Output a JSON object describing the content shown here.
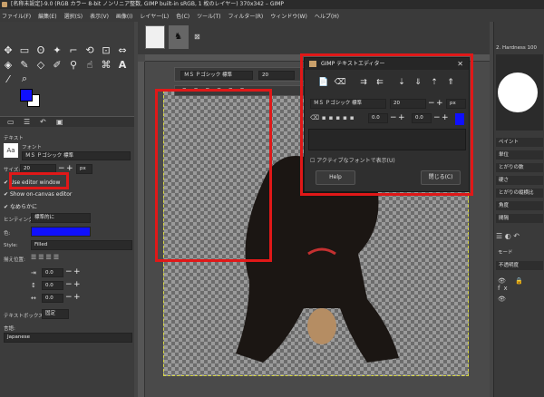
{
  "window": {
    "title": "[名称未設定]-9.0 (RGB カラー 8-bit ノンリニア整数, GIMP built-in sRGB, 1 枚のレイヤー) 370x342 – GIMP"
  },
  "menu": [
    "ファイル(F)",
    "編集(E)",
    "選択(S)",
    "表示(V)",
    "画像(I)",
    "レイヤー(L)",
    "色(C)",
    "ツール(T)",
    "フィルター(R)",
    "ウィンドウ(W)",
    "ヘルプ(H)"
  ],
  "tool_options": {
    "section_title": "テキスト",
    "font_label": "フォント",
    "font_preview": "Aa",
    "font_value": "ＭＳ Ｐゴシック 標準",
    "size_label": "サイズ:",
    "size_value": "20",
    "size_unit": "px",
    "use_editor": "Use editor window",
    "show_canvas_editor": "Show on-canvas editor",
    "antialias": "なめらかに",
    "hinting_label": "ヒンティング:",
    "hinting_value": "標準的に",
    "color_label": "色:",
    "color_hex": "#1010ff",
    "style_label": "Style:",
    "style_value": "Filled",
    "justify_label": "揃え位置:",
    "indent_value": "0.0",
    "line_spacing_value": "0.0",
    "letter_spacing_value": "0.0",
    "box_label": "テキストボックス:",
    "box_value": "固定",
    "language_label": "言語:",
    "language_value": "Japanese"
  },
  "canvas_bar": {
    "font": "ＭＳ Ｐゴシック 標準",
    "size": "20"
  },
  "text_editor": {
    "title": "GIMP テキストエディター",
    "font": "ＭＳ Ｐゴシック 標準",
    "size": "20",
    "unit": "px",
    "baseline": "0.0",
    "kerning": "0.0",
    "use_selected_font": "アクティブなフォントで表示(U)",
    "help": "Help",
    "close": "閉じる(C)"
  },
  "right_panel": {
    "brush": "2. Hardness 100",
    "items": [
      "ペイント",
      "単位",
      "とがりの数",
      "硬さ",
      "とがりの縦横比",
      "角度",
      "間隔"
    ],
    "mode_label": "モード",
    "opacity_label": "不透明度"
  },
  "colors": {
    "accent_red": "#e01818",
    "fg": "#1010ff",
    "bg": "#ffffff"
  }
}
